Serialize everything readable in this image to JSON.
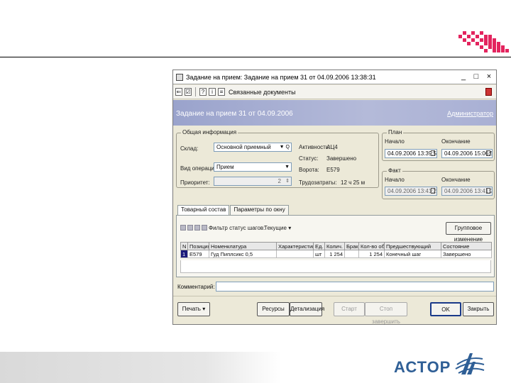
{
  "window": {
    "title": "Задание на прием: Задание на прием 31 от 04.09.2006 13:38:31",
    "controls": [
      "_",
      "□",
      "×"
    ]
  },
  "toolbar": {
    "related_docs_label": "Связанные документы"
  },
  "header": {
    "doc_title": "Задание на прием 31 от 04.09.2006",
    "user": "Администратор"
  },
  "general": {
    "legend": "Общая информация",
    "warehouse_label": "Склад:",
    "warehouse_value": "Основной приемный",
    "op_label": "Вид операции:",
    "op_value": "Прием",
    "priority_label": "Приоритет:",
    "priority_value": "2",
    "activity_label": "Активность:",
    "activity_value": "АЦ4",
    "status_label": "Статус:",
    "status_value": "Завершено",
    "gate_label": "Ворота:",
    "gate_value": "E579",
    "labor_label": "Трудозатраты:",
    "labor_value": "12 ч 25 м"
  },
  "plan": {
    "legend": "План",
    "start_label": "Начало",
    "end_label": "Окончание",
    "start_value": "04.09.2006 13:39:53",
    "end_value": "04.09.2006 15:06:53"
  },
  "fact": {
    "legend": "Факт",
    "start_label": "Начало",
    "end_label": "Окончание",
    "start_value": "04.09.2006 13:41:23",
    "end_value": "04.09.2006 13:41:23"
  },
  "tabs": [
    "Товарный состав",
    "Параметры по окну"
  ],
  "tab_panel": {
    "filter_label": "Фильтр статус шагов:",
    "filter_value": "Текущие",
    "group_button": "Групповое изменение"
  },
  "table": {
    "headers": [
      "N",
      "Позиция",
      "Номенклатура",
      "Характеристика",
      "Ед.",
      "Колич.",
      "Брак",
      "Кол-во обр.",
      "Предшествующий",
      "Состояние"
    ],
    "rows": [
      [
        "1",
        "E579",
        "Гуд Пиплсикс 0,5",
        "",
        "шт",
        "1 254",
        "",
        "1 254",
        "Конечный шаг",
        "Завершено"
      ]
    ]
  },
  "comment_label": "Комментарий:",
  "buttons": {
    "print": "Печать",
    "resources": "Ресурсы",
    "details": "Детализация",
    "start": "Старт",
    "finish": "Стоп завершить",
    "ok": "OK",
    "close": "Закрыть"
  },
  "brand": {
    "text": "АСТОР",
    "color": "#2f5f96",
    "accent": "#e3245e"
  }
}
